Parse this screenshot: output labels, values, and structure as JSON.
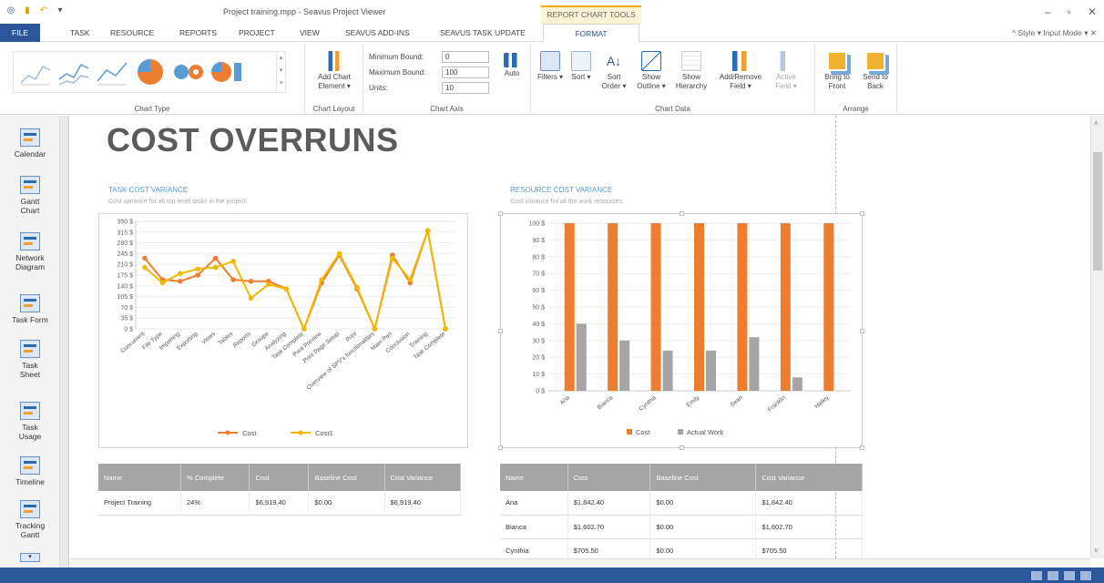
{
  "window": {
    "title": "Project training.mpp - Seavus Project Viewer",
    "contextual_tab_group": "REPORT CHART TOOLS",
    "controls": [
      "–",
      "▫",
      "✕"
    ]
  },
  "tabs": [
    {
      "label": "FILE"
    },
    {
      "label": "TASK"
    },
    {
      "label": "RESOURCE"
    },
    {
      "label": "REPORTS"
    },
    {
      "label": "PROJECT"
    },
    {
      "label": "VIEW"
    },
    {
      "label": "SEAVUS ADD-INS"
    },
    {
      "label": "SEAVUS TASK UPDATE"
    },
    {
      "label": "FORMAT"
    }
  ],
  "tab_right": {
    "text": "^ Style ▾ Input Mode ▾ ✕"
  },
  "ribbon": {
    "chart_type_label": "Chart Type",
    "chart_layout_label": "Chart Layout",
    "add_chart_element": "Add Chart Element ▾",
    "chart_axis_label": "Chart Axis",
    "min_bound_label": "Minimum Bound:",
    "min_bound_value": "0",
    "max_bound_label": "Maximum Bound:",
    "max_bound_value": "100",
    "units_label": "Units:",
    "units_value": "10",
    "auto": "Auto",
    "chart_data_label": "Chart Data",
    "filters": "Filters ▾",
    "sort": "Sort ▾",
    "sort_order": "Sort Order ▾",
    "show_outline": "Show Outline ▾",
    "show_hierarchy": "Show Hierarchy",
    "add_remove_field": "Add/Remove Field ▾",
    "active_field": "Active Field ▾",
    "arrange_label": "Arrange",
    "bring_to_front": "Bring to Front",
    "send_to_back": "Send to Back"
  },
  "sidebar": [
    {
      "label": "Calendar"
    },
    {
      "label": "Gantt Chart"
    },
    {
      "label": "Network Diagram"
    },
    {
      "label": "Task Form"
    },
    {
      "label": "Task Sheet"
    },
    {
      "label": "Task Usage"
    },
    {
      "label": "Timeline"
    },
    {
      "label": "Tracking Gantt"
    }
  ],
  "report": {
    "title": "COST OVERRUNS",
    "task_chart_title": "TASK COST VARIANCE",
    "task_chart_subtitle": "Cost variance for all top-level tasks in the project.",
    "resource_chart_title": "RESOURCE COST VARIANCE",
    "resource_chart_subtitle": "Cost variance for all the work resources.",
    "task_table": {
      "headers": [
        "Name",
        "% Complete",
        "Cost",
        "Baseline Cost",
        "Cost Variance"
      ],
      "rows": [
        [
          "Project Training",
          "24%",
          "$6,919.40",
          "$0.00",
          "$6,919.40"
        ]
      ]
    },
    "resource_table": {
      "headers": [
        "Name",
        "Cost",
        "Baseline Cost",
        "Cost Variance"
      ],
      "rows": [
        [
          "Ana",
          "$1,842.40",
          "$0.00",
          "$1,842.40"
        ],
        [
          "Bianca",
          "$1,602.70",
          "$0.00",
          "$1,602.70"
        ],
        [
          "Cynthia",
          "$705.50",
          "$0.00",
          "$705.50"
        ]
      ]
    }
  },
  "chart_data": [
    {
      "type": "line",
      "title": "TASK COST VARIANCE",
      "categories": [
        "Concurrent",
        "File Type",
        "Importing",
        "Exporting",
        "Views",
        "Tables",
        "Reports",
        "Groups",
        "Analyzing",
        "Task Complete",
        "Print Preview",
        "Print Page Setup",
        "Print",
        "Overview of SPV's functionalities",
        "Main Part",
        "Conclusion",
        "Training",
        "Task Complete"
      ],
      "series": [
        {
          "name": "Cost",
          "color": "#ed7d31",
          "values": [
            230,
            160,
            155,
            175,
            230,
            160,
            155,
            155,
            130,
            0,
            150,
            240,
            130,
            0,
            240,
            150,
            320,
            0
          ]
        },
        {
          "name": "Cost1",
          "color": "#f2b800",
          "values": [
            200,
            150,
            180,
            195,
            200,
            220,
            100,
            145,
            130,
            0,
            160,
            245,
            135,
            0,
            230,
            160,
            320,
            0
          ]
        }
      ],
      "yticks": [
        "350 $",
        "315 $",
        "280 $",
        "245 $",
        "210 $",
        "175 $",
        "140 $",
        "105 $",
        "70 $",
        "35 $",
        "0 $"
      ],
      "ylim": [
        0,
        350
      ],
      "legend": "bottom"
    },
    {
      "type": "bar",
      "title": "RESOURCE COST VARIANCE",
      "categories": [
        "Ana",
        "Bianca",
        "Cynthia",
        "Emily",
        "Sean",
        "Franklin",
        "Hailey"
      ],
      "series": [
        {
          "name": "Cost",
          "color": "#ed7d31",
          "values": [
            100,
            100,
            100,
            100,
            100,
            100,
            100
          ]
        },
        {
          "name": "Actual Work",
          "color": "#a5a5a5",
          "values": [
            40,
            30,
            24,
            24,
            32,
            8,
            0
          ]
        }
      ],
      "yticks": [
        "100 $",
        "90 $",
        "80 $",
        "70 $",
        "60 $",
        "50 $",
        "40 $",
        "30 $",
        "20 $",
        "10 $",
        "0 $"
      ],
      "ylim": [
        0,
        100
      ],
      "legend": "bottom"
    }
  ]
}
